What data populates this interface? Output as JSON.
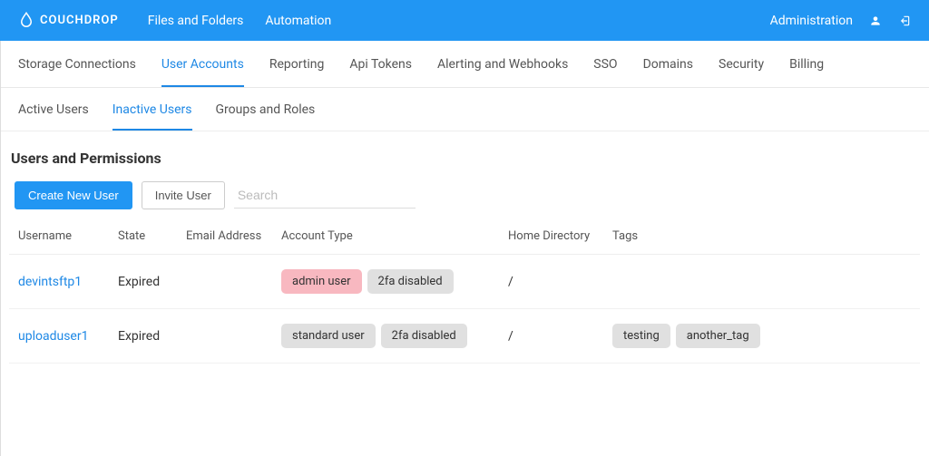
{
  "brand": {
    "name": "COUCHDROP"
  },
  "topnav": {
    "files": "Files and Folders",
    "automation": "Automation",
    "admin": "Administration"
  },
  "tabs": [
    {
      "label": "Storage Connections",
      "selected": false
    },
    {
      "label": "User Accounts",
      "selected": true
    },
    {
      "label": "Reporting",
      "selected": false
    },
    {
      "label": "Api Tokens",
      "selected": false
    },
    {
      "label": "Alerting and Webhooks",
      "selected": false
    },
    {
      "label": "SSO",
      "selected": false
    },
    {
      "label": "Domains",
      "selected": false
    },
    {
      "label": "Security",
      "selected": false
    },
    {
      "label": "Billing",
      "selected": false
    }
  ],
  "subtabs": [
    {
      "label": "Active Users",
      "selected": false
    },
    {
      "label": "Inactive Users",
      "selected": true
    },
    {
      "label": "Groups and Roles",
      "selected": false
    }
  ],
  "page_title": "Users and Permissions",
  "actions": {
    "create": "Create New User",
    "invite": "Invite User",
    "search_placeholder": "Search"
  },
  "columns": {
    "username": "Username",
    "state": "State",
    "email": "Email Address",
    "account_type": "Account Type",
    "home": "Home Directory",
    "tags": "Tags"
  },
  "rows": [
    {
      "username": "devintsftp1",
      "state": "Expired",
      "email": "",
      "account_type": [
        {
          "text": "admin user",
          "style": "pink"
        },
        {
          "text": "2fa disabled",
          "style": "gray"
        }
      ],
      "home": "/",
      "tags": []
    },
    {
      "username": "uploaduser1",
      "state": "Expired",
      "email": "",
      "account_type": [
        {
          "text": "standard user",
          "style": "gray"
        },
        {
          "text": "2fa disabled",
          "style": "gray"
        }
      ],
      "home": "/",
      "tags": [
        {
          "text": "testing",
          "style": "gray"
        },
        {
          "text": "another_tag",
          "style": "gray"
        }
      ]
    }
  ]
}
